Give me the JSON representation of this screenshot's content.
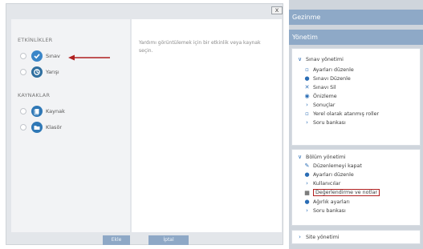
{
  "dialog": {
    "close_label": "x",
    "activities_heading": "ETKİNLİKLER",
    "activities": [
      {
        "label": "Sınav",
        "selected": true,
        "icon": "quiz-icon"
      },
      {
        "label": "Yarışı",
        "selected": false,
        "icon": "contest-icon"
      }
    ],
    "resources_heading": "KAYNAKLAR",
    "resources": [
      {
        "label": "Kaynak",
        "icon": "resource-icon"
      },
      {
        "label": "Klasör",
        "icon": "folder-icon"
      }
    ],
    "hint_text": "Yardımı görüntülemek için bir etkinlik veya kaynak seçin.",
    "ok_label": "Ekle",
    "cancel_label": "İptal"
  },
  "nav": {
    "gezinme_title": "Gezinme",
    "yonetim_title": "Yönetim",
    "quiz_admin": {
      "title": "Sınav yönetimi",
      "items": [
        "Ayarları düzenle",
        "Sınavı Düzenle",
        "Sınavı Sil",
        "Önizleme",
        "Sonuçlar",
        "Yerel olarak atanmış roller",
        "Soru bankası"
      ]
    },
    "section_admin": {
      "title": "Bölüm yönetimi",
      "items": [
        "Düzenlemeyi kapat",
        "Ayarları düzenle",
        "Kullanıcılar",
        "Değerlendirme ve notlar",
        "Ağırlık ayarları",
        "Soru bankası"
      ]
    },
    "site_admin": "Site yönetimi"
  },
  "colors": {
    "header_blue": "#8ea9c7",
    "annotation_red": "#b02020",
    "icon_blue": "#2a6db5"
  }
}
